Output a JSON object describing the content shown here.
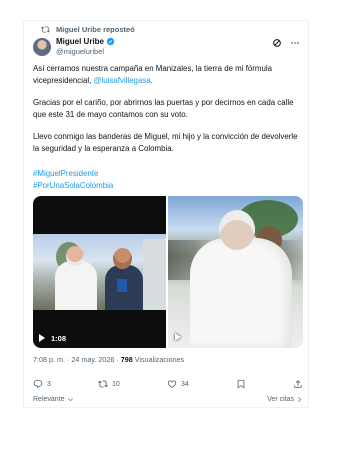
{
  "repost": {
    "label": "Miguel Uribe reposteó"
  },
  "author": {
    "name": "Miguel Uribe",
    "handle": "@migueluribel"
  },
  "post": {
    "p1_a": "Así cerramos nuestra campaña en Manizales, la tierra de mi fórmula vicepresidencial, ",
    "p1_mention": "@luisafvillegasa",
    "p1_b": ".",
    "p2": "Gracias por el cariño, por abrirnos las puertas y por decirnos en cada calle que este 31 de mayo contamos con su voto.",
    "p3": "Llevo conmigo las banderas de Miguel, mi hijo y la convicción de devolverle la seguridad y la esperanza a Colombia.",
    "hashtags": [
      "#MiguelPresidente",
      "#PorUnaSolaColombia"
    ]
  },
  "media": {
    "video1_duration": "1:08"
  },
  "meta": {
    "timestamp": "7:08 p. m. · 24 may. 2026 · ",
    "views_count": "798",
    "views_label": " Visualizaciones"
  },
  "actions": {
    "replies": "3",
    "reposts": "10",
    "likes": "34"
  },
  "footer": {
    "sort_label": "Relevante",
    "quotes_label": "Ver citas"
  },
  "colors": {
    "accent": "#1d9bf0",
    "text": "#0f1419",
    "muted": "#536471"
  },
  "icons": [
    "repost-icon",
    "verified-icon",
    "grok-icon",
    "more-icon",
    "reply-icon",
    "retweet-icon",
    "like-icon",
    "bookmark-icon",
    "share-icon",
    "play-icon",
    "chevron-down-icon",
    "chevron-right-icon"
  ]
}
